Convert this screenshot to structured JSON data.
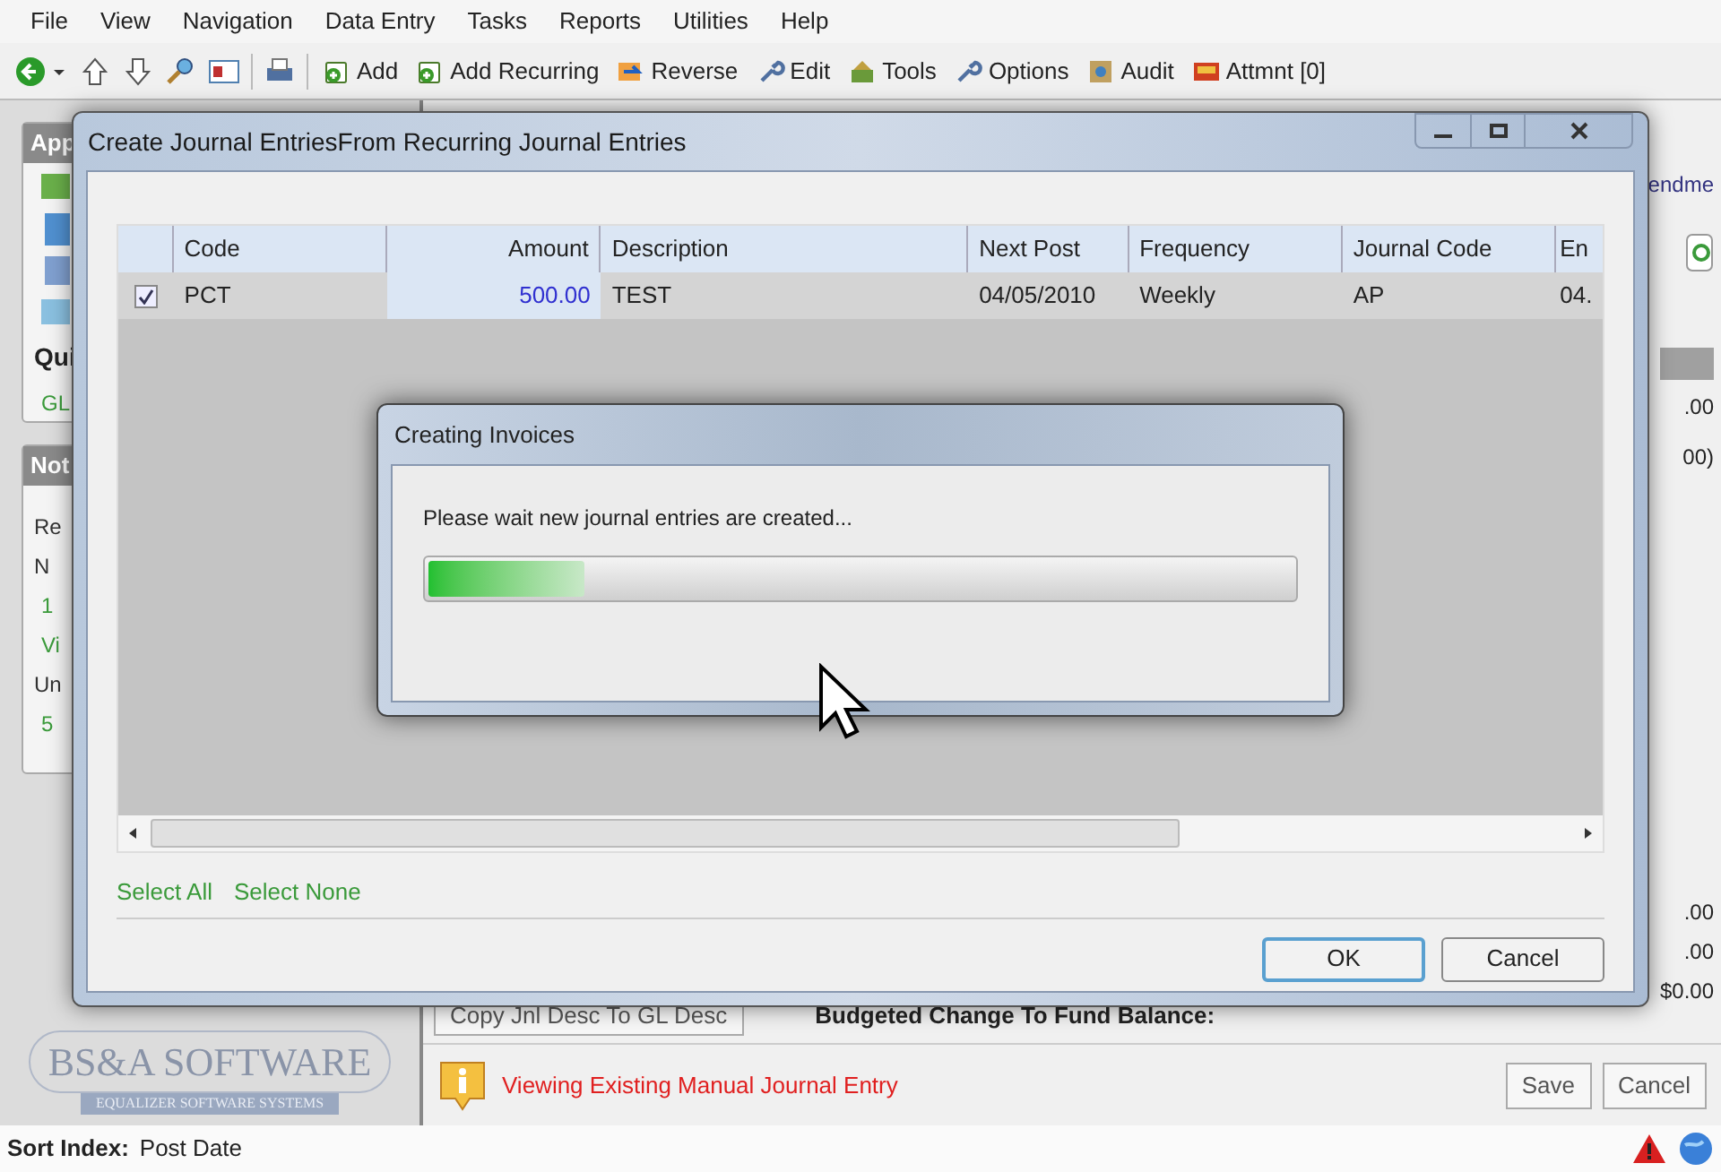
{
  "menu": [
    "File",
    "View",
    "Navigation",
    "Data Entry",
    "Tasks",
    "Reports",
    "Utilities",
    "Help"
  ],
  "toolbar": {
    "buttons": [
      {
        "label": "Add"
      },
      {
        "label": "Add Recurring"
      },
      {
        "label": "Reverse"
      },
      {
        "label": "Edit"
      },
      {
        "label": "Tools"
      },
      {
        "label": "Options"
      },
      {
        "label": "Audit"
      },
      {
        "label": "Attmnt [0]"
      }
    ]
  },
  "left_panel": {
    "cards": [
      {
        "title": "App",
        "items": [
          {
            "kind": "heading",
            "text": "Qui"
          },
          {
            "kind": "link",
            "text": "GL"
          }
        ]
      },
      {
        "title": "Not",
        "items": [
          {
            "kind": "label",
            "text": "Re"
          },
          {
            "kind": "label",
            "text": "N"
          },
          {
            "kind": "link",
            "text": "1"
          },
          {
            "kind": "link",
            "text": "Vi"
          },
          {
            "kind": "label",
            "text": "Un"
          },
          {
            "kind": "link",
            "text": "5"
          }
        ]
      }
    ],
    "logo": {
      "name": "BS&A SOFTWARE",
      "tagline": "EQUALIZER SOFTWARE SYSTEMS"
    }
  },
  "right_panel": {
    "header_fragment": "endme",
    "values": [
      ".00",
      "00)",
      ".00",
      ".00",
      "$0.00"
    ],
    "copy_button": "Copy Jnl Desc To GL Desc",
    "budget_label": "Budgeted Change To Fund Balance:",
    "message": "Viewing Existing Manual Journal Entry",
    "buttons": [
      "Save",
      "Cancel"
    ]
  },
  "status_bar": {
    "label": "Sort Index:",
    "value": "Post Date"
  },
  "dialog": {
    "title": "Create Journal EntriesFrom Recurring Journal Entries",
    "columns": [
      "Code",
      "Amount",
      "Description",
      "Next Post",
      "Frequency",
      "Journal Code",
      "En"
    ],
    "rows": [
      {
        "checked": true,
        "cells": [
          "PCT",
          "500.00",
          "TEST",
          "04/05/2010",
          "Weekly",
          "AP",
          "04."
        ]
      }
    ],
    "links": [
      "Select All",
      "Select None"
    ],
    "buttons": [
      "OK",
      "Cancel"
    ]
  },
  "progress": {
    "title": "Creating Invoices",
    "message": "Please wait new journal entries are created...",
    "level": 0.18
  }
}
